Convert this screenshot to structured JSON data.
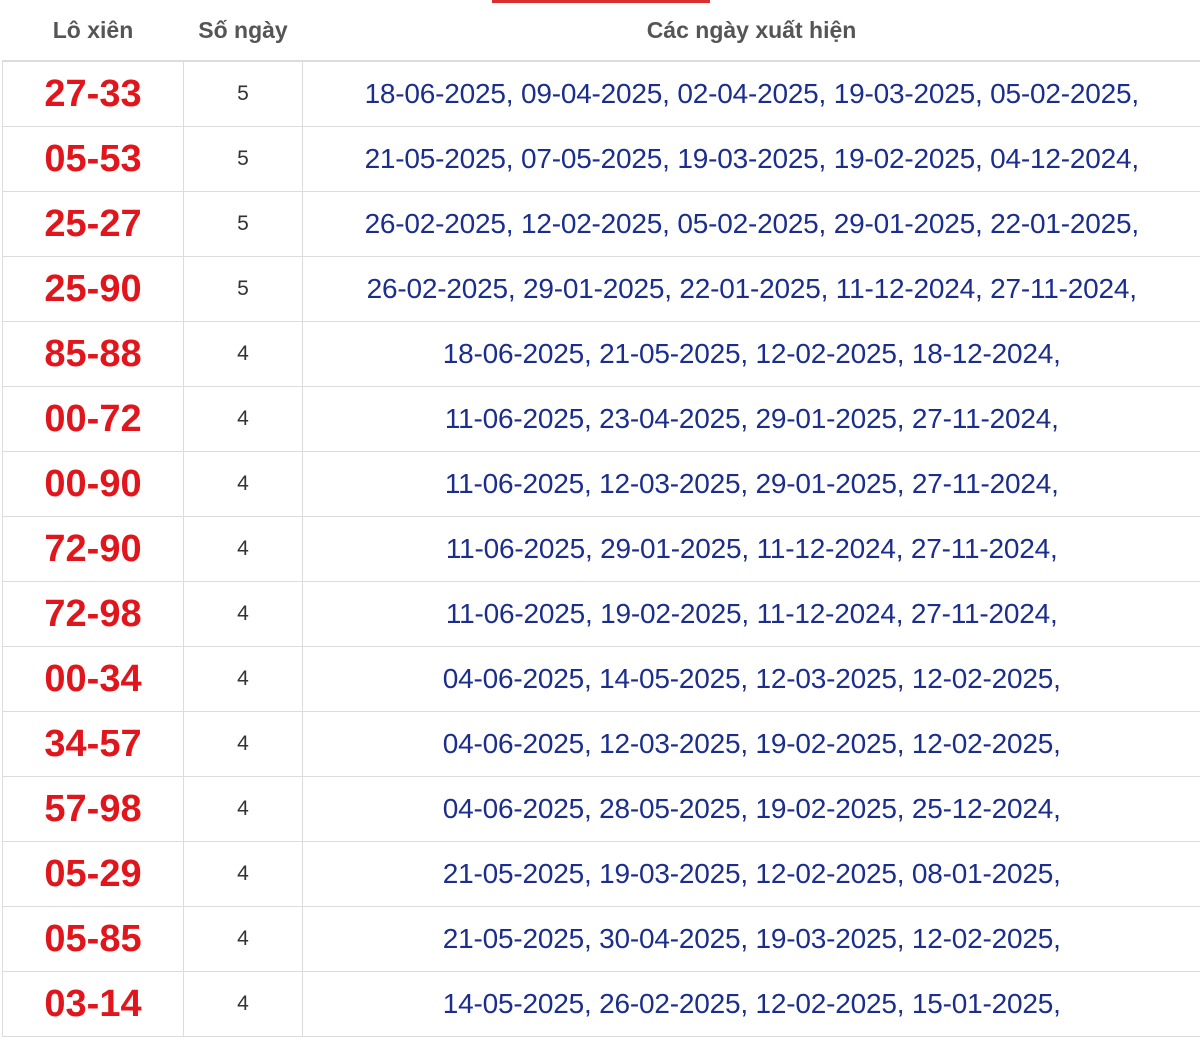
{
  "header": {
    "pair": "Lô xiên",
    "count": "Số ngày",
    "dates": "Các ngày xuất hiện"
  },
  "theme": {
    "pair_color": "#e0161c",
    "dates_color": "#1b2e8c",
    "accent": "#d9302f"
  },
  "rows": [
    {
      "pair": "27-33",
      "count": "5",
      "dates": "18-06-2025, 09-04-2025, 02-04-2025, 19-03-2025, 05-02-2025,"
    },
    {
      "pair": "05-53",
      "count": "5",
      "dates": "21-05-2025, 07-05-2025, 19-03-2025, 19-02-2025, 04-12-2024,"
    },
    {
      "pair": "25-27",
      "count": "5",
      "dates": "26-02-2025, 12-02-2025, 05-02-2025, 29-01-2025, 22-01-2025,"
    },
    {
      "pair": "25-90",
      "count": "5",
      "dates": "26-02-2025, 29-01-2025, 22-01-2025, 11-12-2024, 27-11-2024,"
    },
    {
      "pair": "85-88",
      "count": "4",
      "dates": "18-06-2025, 21-05-2025, 12-02-2025, 18-12-2024,"
    },
    {
      "pair": "00-72",
      "count": "4",
      "dates": "11-06-2025, 23-04-2025, 29-01-2025, 27-11-2024,"
    },
    {
      "pair": "00-90",
      "count": "4",
      "dates": "11-06-2025, 12-03-2025, 29-01-2025, 27-11-2024,"
    },
    {
      "pair": "72-90",
      "count": "4",
      "dates": "11-06-2025, 29-01-2025, 11-12-2024, 27-11-2024,"
    },
    {
      "pair": "72-98",
      "count": "4",
      "dates": "11-06-2025, 19-02-2025, 11-12-2024, 27-11-2024,"
    },
    {
      "pair": "00-34",
      "count": "4",
      "dates": "04-06-2025, 14-05-2025, 12-03-2025, 12-02-2025,"
    },
    {
      "pair": "34-57",
      "count": "4",
      "dates": "04-06-2025, 12-03-2025, 19-02-2025, 12-02-2025,"
    },
    {
      "pair": "57-98",
      "count": "4",
      "dates": "04-06-2025, 28-05-2025, 19-02-2025, 25-12-2024,"
    },
    {
      "pair": "05-29",
      "count": "4",
      "dates": "21-05-2025, 19-03-2025, 12-02-2025, 08-01-2025,"
    },
    {
      "pair": "05-85",
      "count": "4",
      "dates": "21-05-2025, 30-04-2025, 19-03-2025, 12-02-2025,"
    },
    {
      "pair": "03-14",
      "count": "4",
      "dates": "14-05-2025, 26-02-2025, 12-02-2025, 15-01-2025,"
    }
  ]
}
